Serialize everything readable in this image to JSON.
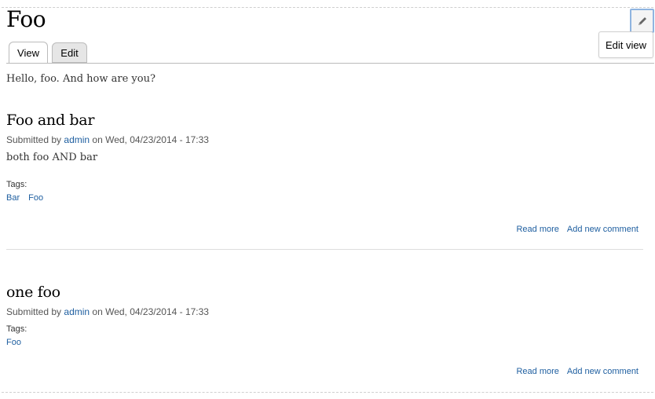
{
  "page": {
    "title": "Foo",
    "intro": "Hello, foo. And how are you?",
    "edit_view_label": "Edit view"
  },
  "tabs": [
    {
      "label": "View",
      "active": true
    },
    {
      "label": "Edit",
      "active": false
    }
  ],
  "nodes": [
    {
      "title": "Foo and bar",
      "submitted_prefix": "Submitted by",
      "author": "admin",
      "submitted_suffix": "on Wed, 04/23/2014 - 17:33",
      "body": "both foo AND bar",
      "tags_label": "Tags:",
      "tags": [
        "Bar",
        "Foo"
      ],
      "read_more": "Read more",
      "add_comment": "Add new comment"
    },
    {
      "title": "one foo",
      "submitted_prefix": "Submitted by",
      "author": "admin",
      "submitted_suffix": "on Wed, 04/23/2014 - 17:33",
      "body": "",
      "tags_label": "Tags:",
      "tags": [
        "Foo"
      ],
      "read_more": "Read more",
      "add_comment": "Add new comment"
    }
  ],
  "icons": {
    "edit": "pencil-icon"
  },
  "colors": {
    "link": "#1f5fa0",
    "contextual_highlight": "#8fb4e0"
  }
}
